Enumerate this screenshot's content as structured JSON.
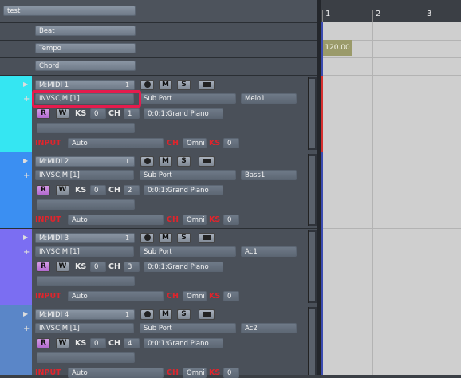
{
  "project": {
    "name": "test"
  },
  "global_tracks": [
    {
      "label": "Beat"
    },
    {
      "label": "Tempo"
    },
    {
      "label": "Chord"
    }
  ],
  "tracks": [
    {
      "name": "M:MIDI 1",
      "num": "1",
      "device": "INVSC,M [1]",
      "port": "Sub Port",
      "part": "Melo1",
      "ks": "0",
      "ch": "1",
      "patch": "0:0:1:Grand Piano",
      "input": "Auto",
      "omni": "Omni",
      "ks_val": "0",
      "color": "#35e6f2"
    },
    {
      "name": "M:MIDI 2",
      "num": "1",
      "device": "INVSC,M [1]",
      "port": "Sub Port",
      "part": "Bass1",
      "ks": "0",
      "ch": "2",
      "patch": "0:0:1:Grand Piano",
      "input": "Auto",
      "omni": "Omni",
      "ks_val": "0",
      "color": "#3b8ff2"
    },
    {
      "name": "M:MIDI 3",
      "num": "1",
      "device": "INVSC,M [1]",
      "port": "Sub Port",
      "part": "Ac1",
      "ks": "0",
      "ch": "3",
      "patch": "0:0:1:Grand Piano",
      "input": "Auto",
      "omni": "Omni",
      "ks_val": "0",
      "color": "#7b6ef2"
    },
    {
      "name": "M:MIDI 4",
      "num": "1",
      "device": "INVSC,M [1]",
      "port": "Sub Port",
      "part": "Ac2",
      "ks": "0",
      "ch": "4",
      "patch": "0:0:1:Grand Piano",
      "input": "Auto",
      "omni": "Omni",
      "ks_val": "0",
      "color": "#5a86c8"
    }
  ],
  "buttons": {
    "mute": "M",
    "solo": "S",
    "read": "R",
    "write": "W"
  },
  "labels": {
    "ks": "KS",
    "ch": "CH",
    "input": "INPUT"
  },
  "icons": {
    "expand": "▶",
    "add": "+"
  },
  "ruler": {
    "bars": [
      "1",
      "2",
      "3"
    ]
  },
  "tempo": {
    "value": "120.00"
  }
}
